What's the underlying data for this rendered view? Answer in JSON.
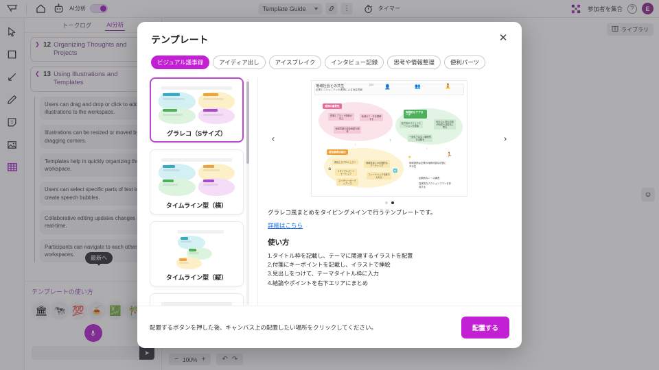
{
  "topbar": {
    "logo_icon": "app-logo-icon",
    "home_icon": "home-icon",
    "robot_icon": "robot-icon",
    "ai_label": "AI分析",
    "template_guide_label": "Template Guide",
    "link_icon": "link-icon",
    "more_icon": "more-vertical-icon",
    "timer_icon": "timer-icon",
    "timer_label": "タイマー",
    "gather_icon": "gather-participants-icon",
    "gather_label": "参加者を集合",
    "help_label": "?",
    "avatar_initial": "E"
  },
  "rail": {
    "items": [
      {
        "name": "select-tool",
        "icon": "cursor-icon"
      },
      {
        "name": "shape-tool",
        "icon": "square-icon"
      },
      {
        "name": "line-tool",
        "icon": "line-arrow-icon"
      },
      {
        "name": "pen-tool",
        "icon": "pencil-icon"
      },
      {
        "name": "sticky-note-tool",
        "icon": "text-note-icon"
      },
      {
        "name": "image-tool",
        "icon": "image-icon"
      },
      {
        "name": "table-tool",
        "icon": "table-grid-icon"
      }
    ]
  },
  "sidebar": {
    "tabs": [
      {
        "label": "トークログ",
        "active": false
      },
      {
        "label": "AI分析",
        "active": true
      }
    ],
    "chapters": [
      {
        "number": "12",
        "title": "Organizing Thoughts and Projects",
        "expanded": false,
        "icon": "📚"
      },
      {
        "number": "13",
        "title": "Using Illustrations and Templates",
        "expanded": true,
        "icon": "🔑"
      }
    ],
    "messages": [
      "Users can drag and drop or click to add illustrations to the workspace.",
      "Illustrations can be resized or moved by dragging corners.",
      "Templates help in quickly organizing the workspace.",
      "Users can select specific parts of text to create speech bubbles.",
      "Collaborative editing updates changes in real-time.",
      "Participants can navigate to each other's workspaces."
    ],
    "latest_pill": "最新へ",
    "footer": {
      "title": "テンプレートの使い方",
      "suggestions": [
        "🏛",
        "🐄",
        "💯",
        "🍝",
        "💹",
        "🎋"
      ],
      "mic_icon": "microphone-icon",
      "input_placeholder": "",
      "send_icon": "send-icon"
    }
  },
  "canvas": {
    "library_label": "ライブラリ",
    "library_icon": "book-icon",
    "emoji_icon": "smiley-face-icon",
    "zoom_out": "−",
    "zoom_level": "100%",
    "zoom_in": "+",
    "undo_icon": "undo-icon",
    "redo_icon": "redo-icon"
  },
  "modal": {
    "title": "テンプレート",
    "close_icon": "close-icon",
    "categories": [
      {
        "label": "ビジュアル議事録",
        "active": true
      },
      {
        "label": "アイディア出し",
        "active": false
      },
      {
        "label": "アイスブレイク",
        "active": false
      },
      {
        "label": "インタビュー記録",
        "active": false
      },
      {
        "label": "思考や情報整理",
        "active": false
      },
      {
        "label": "便利パーツ",
        "active": false
      }
    ],
    "templates": [
      {
        "name": "グラレコ（Sサイズ）",
        "selected": true
      },
      {
        "name": "タイムライン型（横）",
        "selected": false
      },
      {
        "name": "タイムライン型（縦）",
        "selected": false
      },
      {
        "name": "",
        "selected": false
      }
    ],
    "preview": {
      "prev_icon": "chevron-left-icon",
      "next_icon": "chevron-right-icon",
      "dots": [
        false,
        true
      ],
      "image_title": "地域社会との共生",
      "image_subtitle": "企業とコミュニティの連携による社会貢献",
      "image_date": "5/21",
      "image_sections": [
        "連携の重要性",
        "実践的なアプローチ",
        "成功事例の紹介"
      ],
      "image_notes": [
        "信頼とブランド価値の向上",
        "地域のニーズを理解する",
        "地域貢献の波及効果も期待",
        "双方向のコミュニケーションを促進",
        "地元の人材の活用が地域の活性化に寄与",
        "一過性ではなく継続的な活動を",
        "成功したプロジェクト",
        "リサイクルパートナーシップ",
        "ネイチャーガーディアンズ",
        "地域住民との定期的なミーティング",
        "フィードバックを取り入れた",
        "地域連携は企業の持続可能な成長に不可欠",
        "定期的なニーズ調査",
        "具体的なアクションプランを作成する"
      ]
    },
    "description": "グラレコ風まとめをタイピングメインで行うテンプレートです。",
    "detail_link": "詳細はこちら",
    "howto_heading": "使い方",
    "howto_steps": [
      "1.タイトル枠を記載し、テーマに関連するイラストを配置",
      "2.付箋にキーポイントを記載し、イラストで挿絵",
      "3.見出しをつけて、テーマタイトル枠に入力",
      "4.結論やポイントを右下エリアにまとめ"
    ],
    "footer_note": "配置するボタンを押した後、キャンバス上の配置したい場所をクリックしてください。",
    "place_button": "配置する"
  },
  "colors": {
    "accent": "#a020c0",
    "magenta": "#c31fd4",
    "link": "#1a73e8",
    "dark": "#2f2f35"
  }
}
